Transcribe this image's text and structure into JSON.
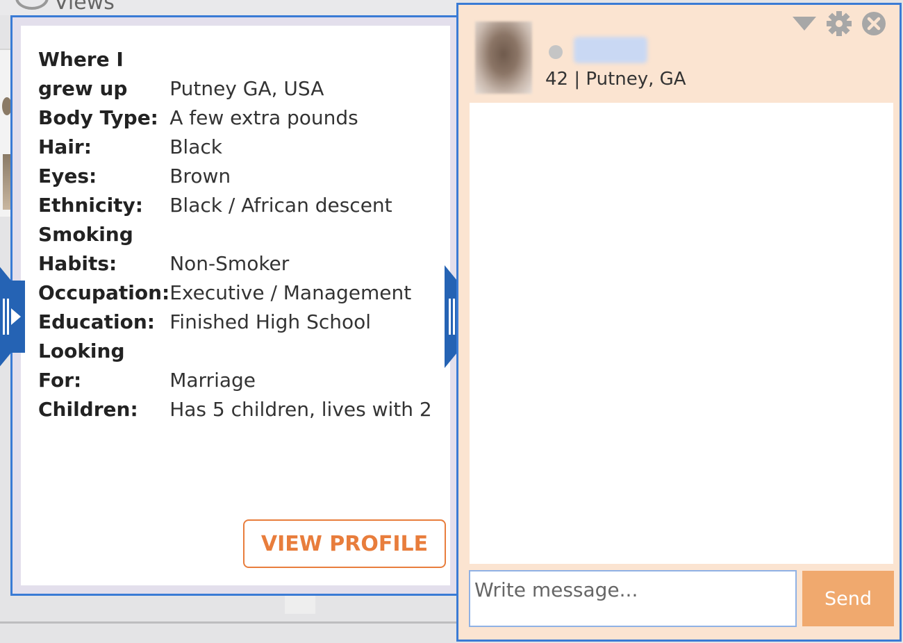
{
  "background": {
    "views_label": "Views"
  },
  "profile": {
    "details": [
      {
        "label": "Where I grew up",
        "value": "Putney GA, USA"
      },
      {
        "label": "Body Type:",
        "value": "A few extra pounds"
      },
      {
        "label": "Hair:",
        "value": "Black"
      },
      {
        "label": "Eyes:",
        "value": "Brown"
      },
      {
        "label": "Ethnicity:",
        "value": "Black / African descent"
      },
      {
        "label": "Smoking Habits:",
        "value": "Non-Smoker"
      },
      {
        "label": "Occupation:",
        "value": "Executive / Management"
      },
      {
        "label": "Education:",
        "value": "Finished High School"
      },
      {
        "label": "Looking For:",
        "value": "Marriage"
      },
      {
        "label": "Children:",
        "value": "Has 5 children, lives with 2"
      }
    ],
    "view_profile_label": "VIEW PROFILE"
  },
  "chat": {
    "subtitle": "42 | Putney, GA",
    "status": "offline",
    "input_placeholder": "Write message...",
    "send_label": "Send",
    "icons": [
      "minimize-arrow-icon",
      "gear-icon",
      "close-icon"
    ]
  },
  "colors": {
    "accent_blue": "#3a7bd5",
    "handle_blue": "#2563b4",
    "orange": "#e87d3c",
    "send_orange": "#f0a96e",
    "chat_bg": "#fbe4d1"
  }
}
